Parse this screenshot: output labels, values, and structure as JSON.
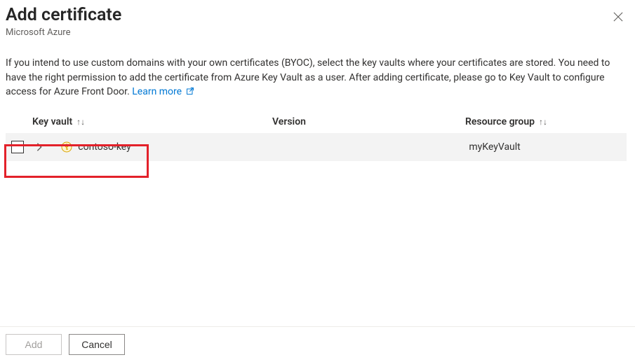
{
  "header": {
    "title": "Add certificate",
    "subtitle": "Microsoft Azure"
  },
  "description": {
    "text": "If you intend to use custom domains with your own certificates (BYOC), select the key vaults where your certificates are stored. You need to have the right permission to add the certificate from Azure Key Vault as a user. After adding certificate, please go to Key Vault to configure access for Azure Front Door.",
    "learn_more_label": "Learn more"
  },
  "table": {
    "columns": {
      "key_vault": "Key vault",
      "version": "Version",
      "resource_group": "Resource group"
    },
    "rows": [
      {
        "key_vault": "contoso-key",
        "version": "",
        "resource_group": "myKeyVault",
        "checked": false,
        "expanded": false
      }
    ]
  },
  "footer": {
    "add_label": "Add",
    "cancel_label": "Cancel",
    "add_enabled": false
  }
}
